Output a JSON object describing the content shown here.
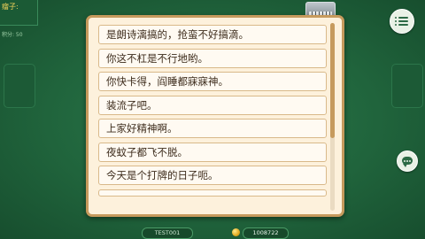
{
  "player_tl": {
    "name": "瘤子:",
    "score": "积分: 50"
  },
  "phrases": [
    "是朗诗漓搞的，抢蛮不好搞滴。",
    "你这不杠是不行地哟。",
    "你快卡得，阎睡都寐寐神。",
    "装流子吧。",
    "上家好精神啊。",
    "夜蚊子都飞不脱。",
    "今天是个打牌的日子呃。"
  ],
  "bottom": {
    "player_name": "TEST001",
    "coins": "1008722"
  },
  "colors": {
    "felt": "#20643c",
    "panel_bg": "#fdf1dc",
    "panel_border": "#c69a5d",
    "name_gold": "#f0d25a"
  }
}
